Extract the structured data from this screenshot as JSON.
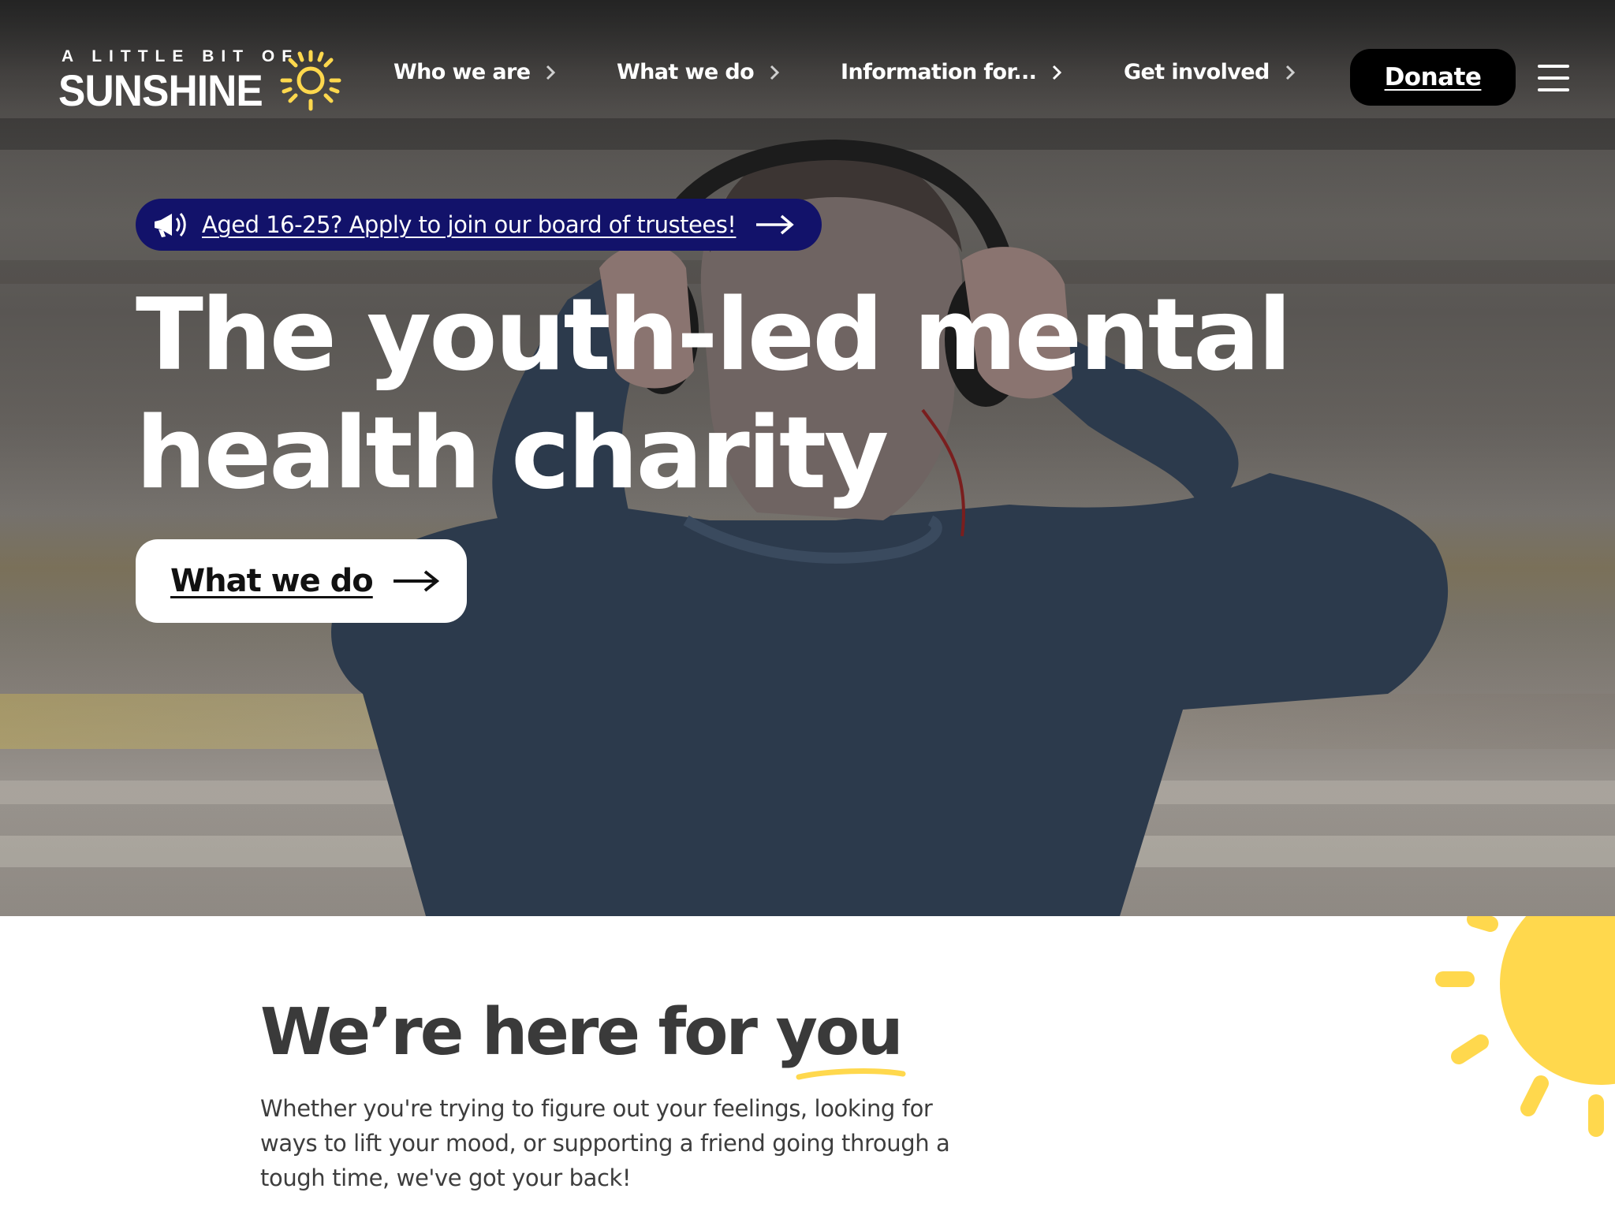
{
  "logo": {
    "top_line": "A LITTLE BIT OF",
    "main_word": "SUNSHINE"
  },
  "nav": {
    "items": [
      {
        "label": "Who we are"
      },
      {
        "label": "What we do"
      },
      {
        "label": "Information for..."
      },
      {
        "label": "Get involved"
      }
    ],
    "donate_label": "Donate"
  },
  "announcement": {
    "text": "Aged 16-25? Apply to join our board of trustees!"
  },
  "hero": {
    "headline": "The youth-led mental health charity",
    "cta_label": "What we do"
  },
  "intro": {
    "title_start": "We’re here for ",
    "title_emphasis": "you",
    "body": "Whether you're trying to figure out your feelings, looking for ways to lift your mood, or supporting a friend going through a tough time, we've got your back!"
  },
  "colors": {
    "brand_yellow": "#FFD84D",
    "announcement_bg": "#12126A",
    "donate_bg": "#000000",
    "text_dark": "#3A3A3A"
  },
  "icons": {
    "logo_sun": "sun-icon",
    "nav_chevron": "chevron-right-icon",
    "announcement": "megaphone-icon",
    "arrow": "arrow-right-icon",
    "menu": "hamburger-menu-icon"
  }
}
